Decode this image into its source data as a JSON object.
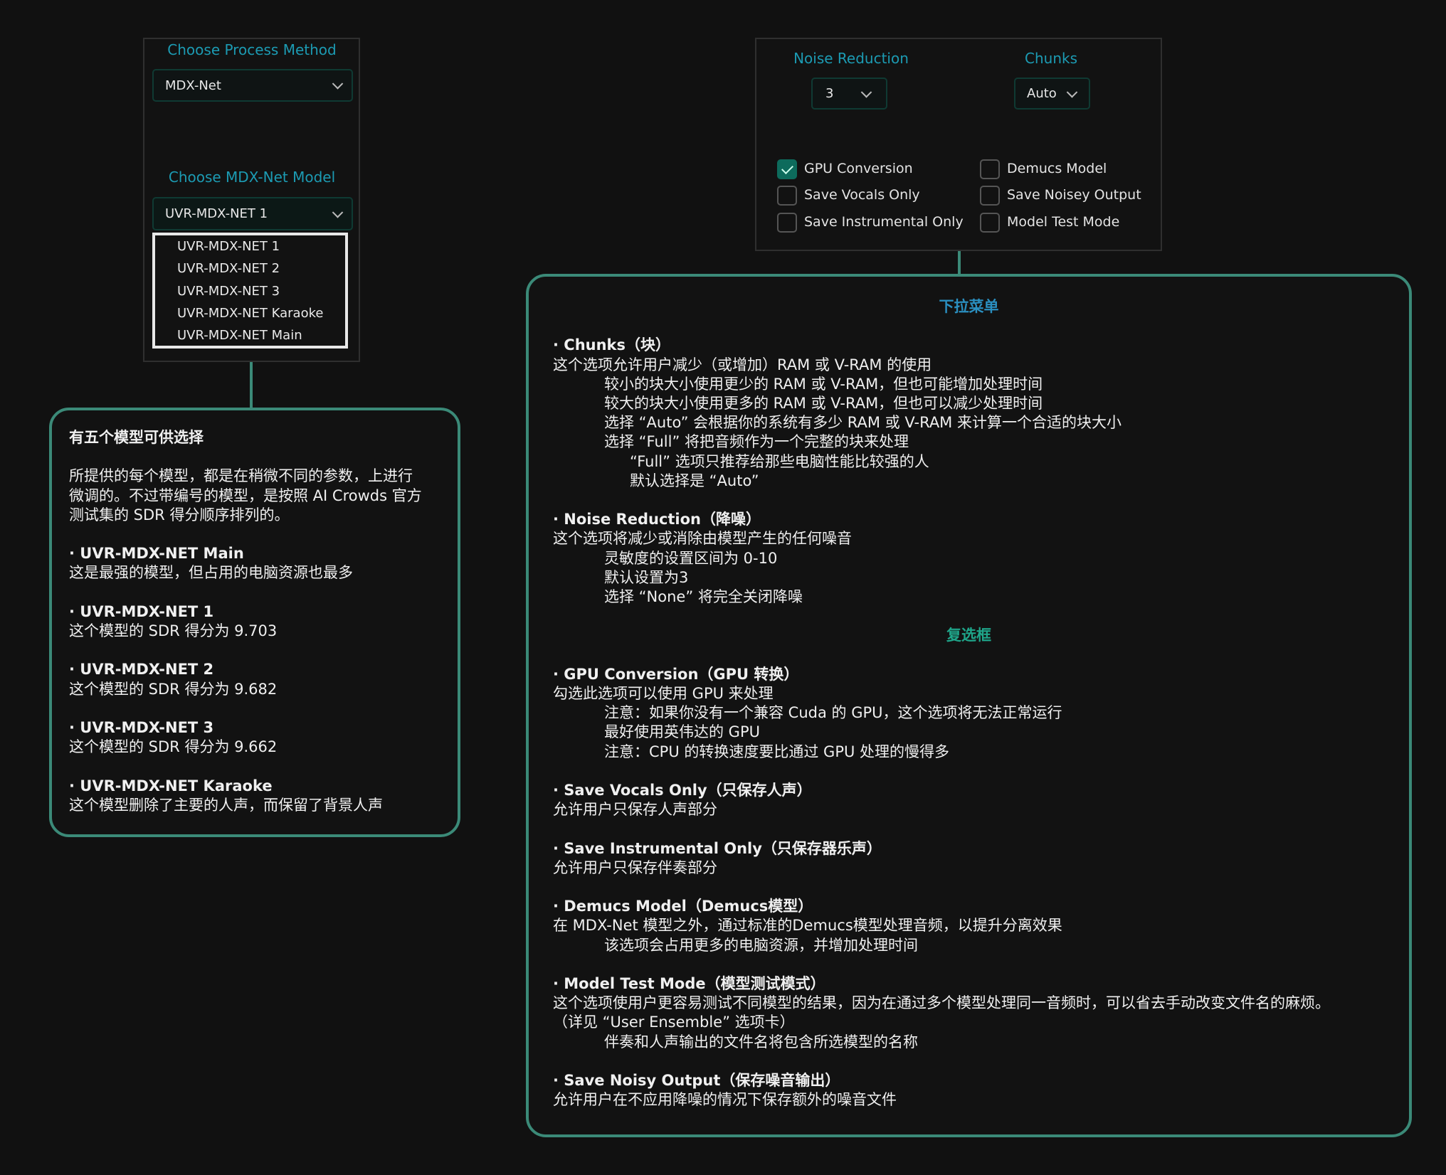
{
  "left_panel": {
    "process_method_label": "Choose Process Method",
    "process_method_value": "MDX-Net",
    "model_label": "Choose MDX-Net Model",
    "model_value": "UVR-MDX-NET 1",
    "model_options": [
      "UVR-MDX-NET 1",
      "UVR-MDX-NET 2",
      "UVR-MDX-NET 3",
      "UVR-MDX-NET Karaoke",
      "UVR-MDX-NET Main"
    ]
  },
  "right_panel": {
    "noise_reduction_label": "Noise Reduction",
    "noise_reduction_value": "3",
    "chunks_label": "Chunks",
    "chunks_value": "Auto",
    "checkboxes": [
      {
        "label": "GPU Conversion",
        "checked": true
      },
      {
        "label": "Save Vocals Only",
        "checked": false
      },
      {
        "label": "Save Instrumental Only",
        "checked": false
      },
      {
        "label": "Demucs Model",
        "checked": false
      },
      {
        "label": "Save Noisey Output",
        "checked": false
      },
      {
        "label": "Model Test Mode",
        "checked": false
      }
    ]
  },
  "colors": {
    "accent_teal": "#3b8a78",
    "label_blue": "#1c9bb3",
    "section_blue": "#2a8fc0",
    "section_green": "#1fa58a",
    "checkbox_on": "#0d6b5c"
  },
  "models_note": {
    "lines": [
      {
        "text": "有五个模型可供选择",
        "style": "title"
      },
      {
        "text": ""
      },
      {
        "text": "所提供的每个模型，都是在稍微不同的参数，上进行"
      },
      {
        "text": "微调的。不过带编号的模型，是按照 AI Crowds 官方"
      },
      {
        "text": "测试集的 SDR 得分顺序排列的。"
      },
      {
        "text": ""
      },
      {
        "text": "· UVR-MDX-NET Main",
        "style": "b"
      },
      {
        "text": "这是最强的模型，但占用的电脑资源也最多"
      },
      {
        "text": ""
      },
      {
        "text": "· UVR-MDX-NET 1",
        "style": "b"
      },
      {
        "text": "这个模型的 SDR 得分为 9.703"
      },
      {
        "text": ""
      },
      {
        "text": "· UVR-MDX-NET 2",
        "style": "b"
      },
      {
        "text": "这个模型的 SDR 得分为 9.682"
      },
      {
        "text": ""
      },
      {
        "text": "· UVR-MDX-NET 3",
        "style": "b"
      },
      {
        "text": "这个模型的 SDR 得分为 9.662"
      },
      {
        "text": ""
      },
      {
        "text": "· UVR-MDX-NET Karaoke",
        "style": "b"
      },
      {
        "text": "这个模型删除了主要的人声，而保留了背景人声"
      }
    ]
  },
  "options_note": {
    "lines": [
      {
        "text": "下拉菜单",
        "style": "section",
        "color": "#2a8fc0"
      },
      {
        "text": ""
      },
      {
        "text": "· Chunks（块）",
        "style": "b"
      },
      {
        "text": "这个选项允许用户减少（或增加）RAM 或 V-RAM 的使用"
      },
      {
        "text": "较小的块大小使用更少的 RAM 或 V-RAM，但也可能增加处理时间",
        "indent": 1
      },
      {
        "text": "较大的块大小使用更多的 RAM 或 V-RAM，但也可以减少处理时间",
        "indent": 1
      },
      {
        "text": "选择 “Auto” 会根据你的系统有多少 RAM 或 V-RAM 来计算一个合适的块大小",
        "indent": 1
      },
      {
        "text": "选择 “Full” 将把音频作为一个完整的块来处理",
        "indent": 1
      },
      {
        "text": "“Full” 选项只推荐给那些电脑性能比较强的人",
        "indent": 2
      },
      {
        "text": "默认选择是 “Auto”",
        "indent": 2
      },
      {
        "text": ""
      },
      {
        "text": "· Noise Reduction（降噪）",
        "style": "b"
      },
      {
        "text": "这个选项将减少或消除由模型产生的任何噪音"
      },
      {
        "text": "灵敏度的设置区间为 0-10",
        "indent": 1
      },
      {
        "text": "默认设置为3",
        "indent": 1
      },
      {
        "text": "选择 “None” 将完全关闭降噪",
        "indent": 1
      },
      {
        "text": ""
      },
      {
        "text": "复选框",
        "style": "section",
        "color": "#1fa58a"
      },
      {
        "text": ""
      },
      {
        "text": "· GPU Conversion（GPU 转换）",
        "style": "b"
      },
      {
        "text": "勾选此选项可以使用 GPU 来处理"
      },
      {
        "text": "注意：如果你没有一个兼容 Cuda 的 GPU，这个选项将无法正常运行",
        "indent": 1
      },
      {
        "text": "最好使用英伟达的 GPU",
        "indent": 1
      },
      {
        "text": "注意：CPU 的转换速度要比通过 GPU 处理的慢得多",
        "indent": 1
      },
      {
        "text": ""
      },
      {
        "text": "· Save Vocals Only（只保存人声）",
        "style": "b"
      },
      {
        "text": "允许用户只保存人声部分"
      },
      {
        "text": ""
      },
      {
        "text": "· Save Instrumental Only（只保存器乐声）",
        "style": "b"
      },
      {
        "text": "允许用户只保存伴奏部分"
      },
      {
        "text": ""
      },
      {
        "text": "· Demucs Model（Demucs模型）",
        "style": "b"
      },
      {
        "text": "在 MDX-Net 模型之外，通过标准的Demucs模型处理音频，以提升分离效果"
      },
      {
        "text": "该选项会占用更多的电脑资源，并增加处理时间",
        "indent": 1
      },
      {
        "text": ""
      },
      {
        "text": "· Model Test Mode（模型测试模式）",
        "style": "b"
      },
      {
        "text": "这个选项使用户更容易测试不同模型的结果，因为在通过多个模型处理同一音频时，可以省去手动改变文件名的麻烦。"
      },
      {
        "text": "（详见 “User Ensemble” 选项卡）"
      },
      {
        "text": "伴奏和人声输出的文件名将包含所选模型的名称",
        "indent": 1
      },
      {
        "text": ""
      },
      {
        "text": "· Save Noisy Output（保存噪音输出）",
        "style": "b"
      },
      {
        "text": "允许用户在不应用降噪的情况下保存额外的噪音文件"
      }
    ]
  }
}
